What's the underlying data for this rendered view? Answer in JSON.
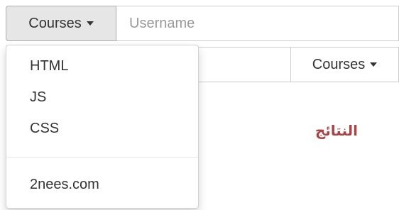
{
  "group1": {
    "dropdown_label": "Courses",
    "username_placeholder": "Username"
  },
  "group2": {
    "dropdown_label": "Courses"
  },
  "result_label": "النتائج",
  "menu": {
    "items": [
      "HTML",
      "JS",
      "CSS"
    ],
    "footer_item": "2nees.com"
  }
}
